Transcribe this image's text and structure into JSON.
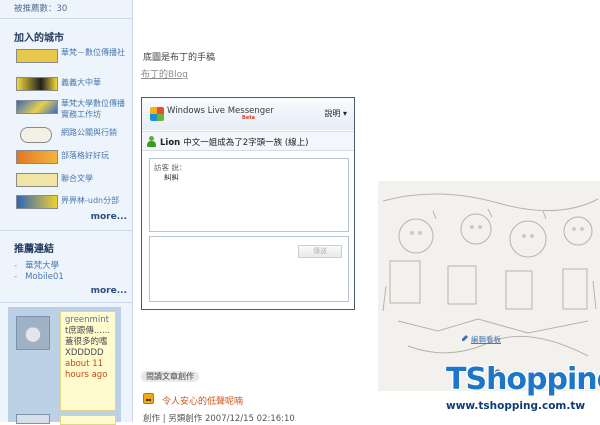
{
  "sidebar": {
    "push_count": "被推薦數：30",
    "cities_title": "加入的城市",
    "cities": [
      {
        "label": "華梵－數位傳播社",
        "icon": "city-badge-icon",
        "color": "#e8c84a"
      },
      {
        "label": "義義大中華",
        "icon": "city-badge-icon",
        "color": "#f2d93a"
      },
      {
        "label": "華梵大學數位傳播實務工作坊",
        "icon": "city-badge-icon",
        "color": "#3a68c8"
      },
      {
        "label": "網路公關與行銷",
        "icon": "city-badge-icon",
        "color": "#f4f0e6"
      },
      {
        "label": "部落格好好玩",
        "icon": "city-badge-icon",
        "color": "#e0782a"
      },
      {
        "label": "聯合文學",
        "icon": "city-badge-icon",
        "color": "#f1e5a6"
      },
      {
        "label": "畀畀林-udn分部",
        "icon": "city-badge-icon",
        "color": "#3064b8"
      }
    ],
    "more_1": "more...",
    "links_title": "推薦連結",
    "links": [
      {
        "label": "華梵大學"
      },
      {
        "label": "Mobile01"
      }
    ],
    "more_2": "more...",
    "guestbook": {
      "who": "greenmint",
      "text": "t庶跟傳......蓋很多的嗜XDDDDD",
      "when": "about 11 hours ago"
    }
  },
  "main": {
    "caption": "底圖是布丁的手稿",
    "blog_link": "布丁的Blog",
    "messenger": {
      "title": "Windows Live Messenger",
      "beta": "Beta",
      "help": "說明 ▾",
      "status_name": "Lion",
      "status_text": "中文一姐成為了2字頭一族 (線上)",
      "sender": "訪客 說：",
      "message": "糾糾",
      "send_button": "傳送"
    },
    "category": "閱讀文章創作",
    "post_title": "令人安心的低聲呢喃",
    "post_meta": "創作 | 另類創作    2007/12/15 02:16:10"
  },
  "overlay": {
    "edit_link": "編輯看板",
    "watermark_brand": "TShopping",
    "watermark_url": "www.tshopping.com.tw",
    "partial_count": "56"
  },
  "colors": {
    "sidebar_bg": "#eef4fb",
    "link": "#4a78b0",
    "post_title": "#d0571d",
    "brand": "#1e76c9"
  }
}
